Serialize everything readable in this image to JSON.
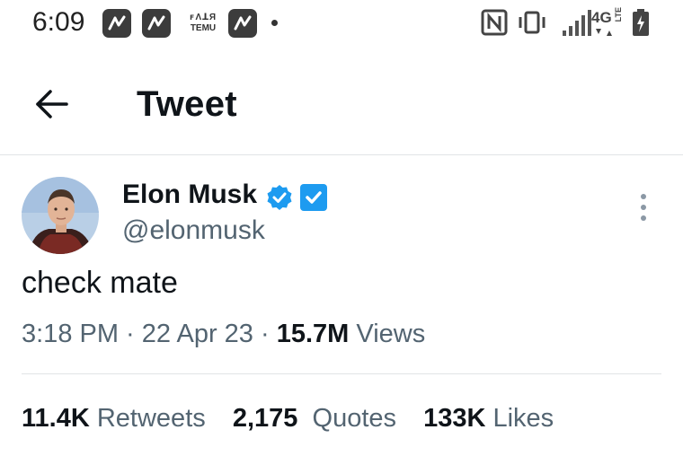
{
  "status_bar": {
    "time": "6:09",
    "temu_label_top": "ꜰɅꓕЯ",
    "temu_label": "TEMU",
    "network": "4G",
    "network_sub": "LTE",
    "icons": [
      "n-app-icon",
      "n-app-icon",
      "temu-icon",
      "n-app-icon",
      "notification-dot-icon",
      "nfc-icon",
      "vibrate-icon",
      "signal-icon",
      "battery-charging-icon"
    ]
  },
  "header": {
    "back_icon": "arrow-left-icon",
    "title": "Tweet"
  },
  "tweet": {
    "author_name": "Elon Musk",
    "handle": "@elonmusk",
    "verified_icon": "verified-check-icon",
    "twitter_badge_icon": "twitter-blue-badge-icon",
    "more_icon": "more-vertical-icon",
    "text": "check mate",
    "time": "3:18 PM",
    "sep1": " · ",
    "date": "22 Apr 23",
    "sep2": " · ",
    "views_count": "15.7M",
    "views_label": "Views"
  },
  "stats": {
    "retweets_count": "11.4K",
    "retweets_label": "Retweets",
    "quotes_count": "2,175",
    "quotes_label": "Quotes",
    "likes_count": "133K",
    "likes_label": "Likes"
  },
  "colors": {
    "accent": "#1d9bf0",
    "text": "#0f1419",
    "muted": "#536471",
    "divider": "#e1e4e6"
  }
}
